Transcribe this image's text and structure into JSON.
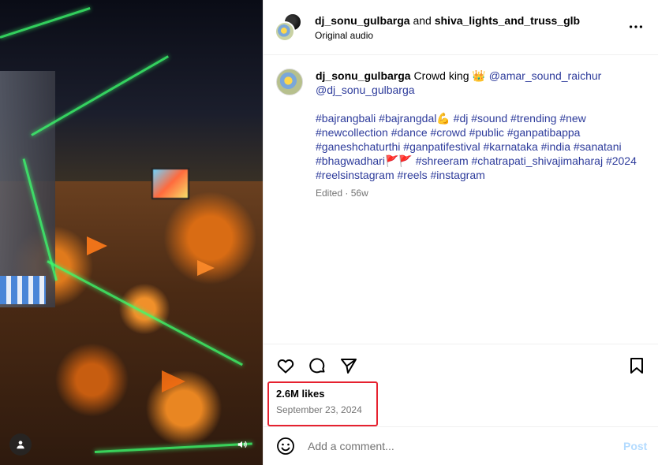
{
  "header": {
    "user1": "dj_sonu_gulbarga",
    "joiner": "and",
    "user2": "shiva_lights_and_truss_glb",
    "audio": "Original audio",
    "more_icon": "more-horizontal-icon"
  },
  "caption": {
    "username": "dj_sonu_gulbarga",
    "text": "Crowd king 👑",
    "mention1": "@amar_sound_raichur",
    "mention2": "@dj_sonu_gulbarga",
    "hashtags": "#bajrangbali #bajrangdal💪 #dj #sound #trending #new #newcollection #dance #crowd #public #ganpatibappa #ganeshchaturthi #ganpatifestival #karnataka #india #sanatani #bhagwadhari🚩🚩 #shreeram #chatrapati_shivajimaharaj #2024 #reelsinstagram #reels #instagram",
    "edited": "Edited",
    "separator": "·",
    "age": "56w"
  },
  "stats": {
    "likes": "2.6M likes",
    "date": "September 23, 2024",
    "highlight_color": "#e6212f"
  },
  "comment": {
    "placeholder": "Add a comment...",
    "post_label": "Post",
    "post_color": "#b3dbff"
  },
  "colors": {
    "link": "#2d3b9b",
    "secondary_text": "#737373",
    "divider": "#efefef"
  }
}
